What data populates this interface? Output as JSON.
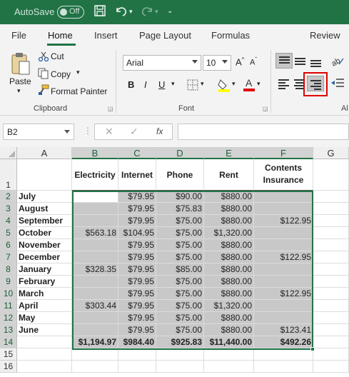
{
  "titlebar": {
    "autosave_label": "AutoSave",
    "toggle_state": "Off"
  },
  "tabs": [
    "File",
    "Home",
    "Insert",
    "Page Layout",
    "Formulas",
    "Review"
  ],
  "ribbon": {
    "paste_label": "Paste",
    "cut_label": "Cut",
    "copy_label": "Copy",
    "format_painter_label": "Format Painter",
    "clipboard_group": "Clipboard",
    "font_name": "Arial",
    "font_size": "10",
    "bold_label": "B",
    "italic_label": "I",
    "underline_label": "U",
    "font_group": "Font",
    "alignment_group_partial": "Al",
    "accent_color": "#217346",
    "highlight_color": "#ffff00",
    "font_color": "#e00000"
  },
  "formula_bar": {
    "cell_ref": "B2",
    "fx_label": "fx",
    "formula": ""
  },
  "sheet": {
    "columns": [
      "A",
      "B",
      "C",
      "D",
      "E",
      "F",
      "G"
    ],
    "rows": [
      "1",
      "2",
      "3",
      "4",
      "5",
      "6",
      "7",
      "8",
      "9",
      "10",
      "11",
      "12",
      "13",
      "14",
      "15",
      "16"
    ],
    "headers": [
      "Electricity",
      "Internet",
      "Phone",
      "Rent",
      "Contents",
      "Insurance"
    ],
    "months": [
      "July",
      "August",
      "September",
      "October",
      "November",
      "December",
      "January",
      "February",
      "March",
      "April",
      " May",
      "June"
    ],
    "data": [
      [
        "",
        "$79.95",
        "$90.00",
        "$880.00",
        ""
      ],
      [
        "",
        "$79.95",
        "$75.83",
        "$880.00",
        ""
      ],
      [
        "",
        "$79.95",
        "$75.00",
        "$880.00",
        "$122.95"
      ],
      [
        "$563.18",
        "$104.95",
        "$75.00",
        "$1,320.00",
        ""
      ],
      [
        "",
        "$79.95",
        "$75.00",
        "$880.00",
        ""
      ],
      [
        "",
        "$79.95",
        "$75.00",
        "$880.00",
        "$122.95"
      ],
      [
        "$328.35",
        "$79.95",
        "$85.00",
        "$880.00",
        ""
      ],
      [
        "",
        "$79.95",
        "$75.00",
        "$880.00",
        ""
      ],
      [
        "",
        "$79.95",
        "$75.00",
        "$880.00",
        "$122.95"
      ],
      [
        "$303.44",
        "$79.95",
        "$75.00",
        "$1,320.00",
        ""
      ],
      [
        "",
        "$79.95",
        "$75.00",
        "$880.00",
        ""
      ],
      [
        "",
        "$79.95",
        "$75.00",
        "$880.00",
        "$123.41"
      ]
    ],
    "totals": [
      "$1,194.97",
      "$984.40",
      "$925.83",
      "$11,440.00",
      "$492.26"
    ]
  }
}
